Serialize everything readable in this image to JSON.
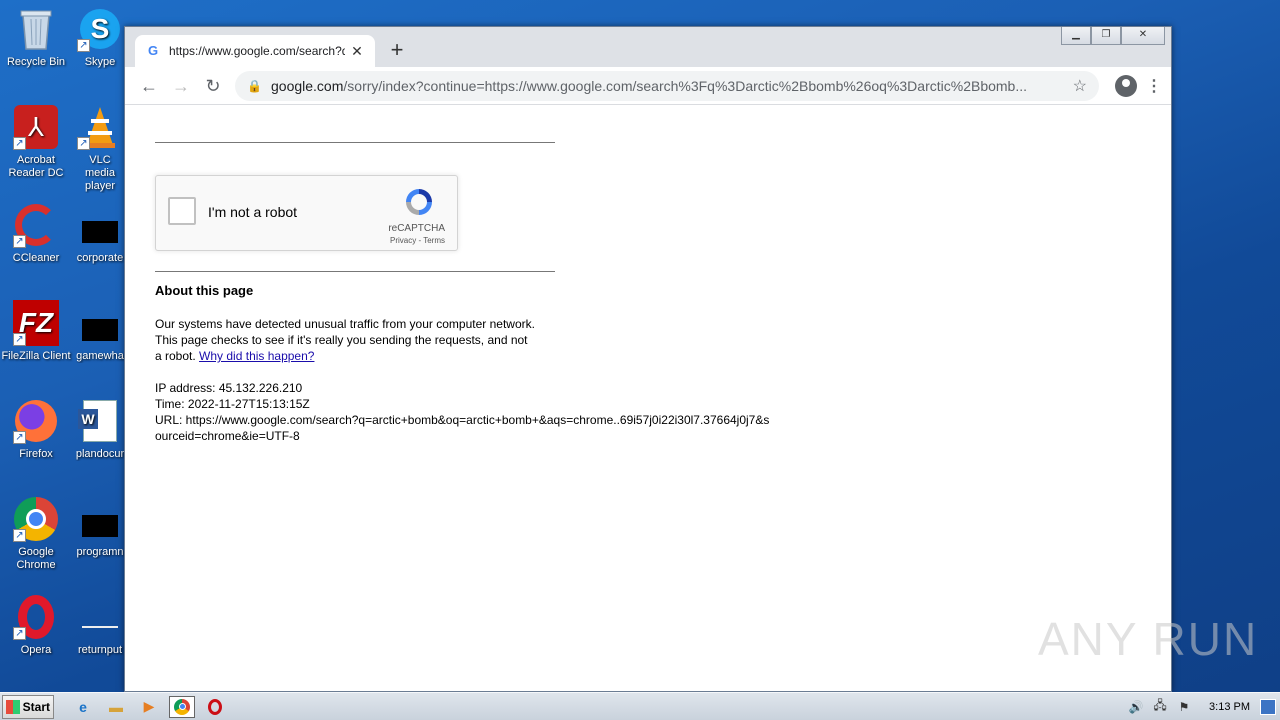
{
  "desktop": {
    "icons": [
      {
        "label": "Recycle Bin",
        "icon": "recycle-bin-icon"
      },
      {
        "label": "Skype",
        "icon": "skype-icon"
      },
      {
        "label": "Acrobat Reader DC",
        "icon": "acrobat-icon"
      },
      {
        "label": "VLC media player",
        "icon": "vlc-icon"
      },
      {
        "label": "CCleaner",
        "icon": "ccleaner-icon"
      },
      {
        "label": "corporate",
        "icon": "file-icon"
      },
      {
        "label": "FileZilla Client",
        "icon": "filezilla-icon"
      },
      {
        "label": "gamewha",
        "icon": "file-icon"
      },
      {
        "label": "Firefox",
        "icon": "firefox-icon"
      },
      {
        "label": "plandocur",
        "icon": "word-icon"
      },
      {
        "label": "Google Chrome",
        "icon": "chrome-icon"
      },
      {
        "label": "programn",
        "icon": "file-icon"
      },
      {
        "label": "Opera",
        "icon": "opera-icon"
      },
      {
        "label": "returnput",
        "icon": "file-icon"
      }
    ]
  },
  "browser": {
    "tab_title": "https://www.google.com/search?q=",
    "tab_favicon": "G",
    "newtab_label": "+",
    "url_host": "google.com",
    "url_rest": "/sorry/index?continue=https://www.google.com/search%3Fq%3Darctic%2Bbomb%26oq%3Darctic%2Bbomb..."
  },
  "page": {
    "captcha_label": "I'm not a robot",
    "recaptcha_name": "reCAPTCHA",
    "recaptcha_links": "Privacy - Terms",
    "about_title": "About this page",
    "about_text": "Our systems have detected unusual traffic from your computer network. This page checks to see if it's really you sending the requests, and not a robot.",
    "why_link": "Why did this happen?",
    "ip_line": "IP address: 45.132.226.210",
    "time_line": "Time: 2022-11-27T15:13:15Z",
    "url_line": "URL: https://www.google.com/search?q=arctic+bomb&oq=arctic+bomb+&aqs=chrome..69i57j0i22i30l7.37664j0j7&sourceid=chrome&ie=UTF-8"
  },
  "taskbar": {
    "start_label": "Start",
    "clock": "3:13 PM"
  },
  "watermark": "ANY RUN"
}
